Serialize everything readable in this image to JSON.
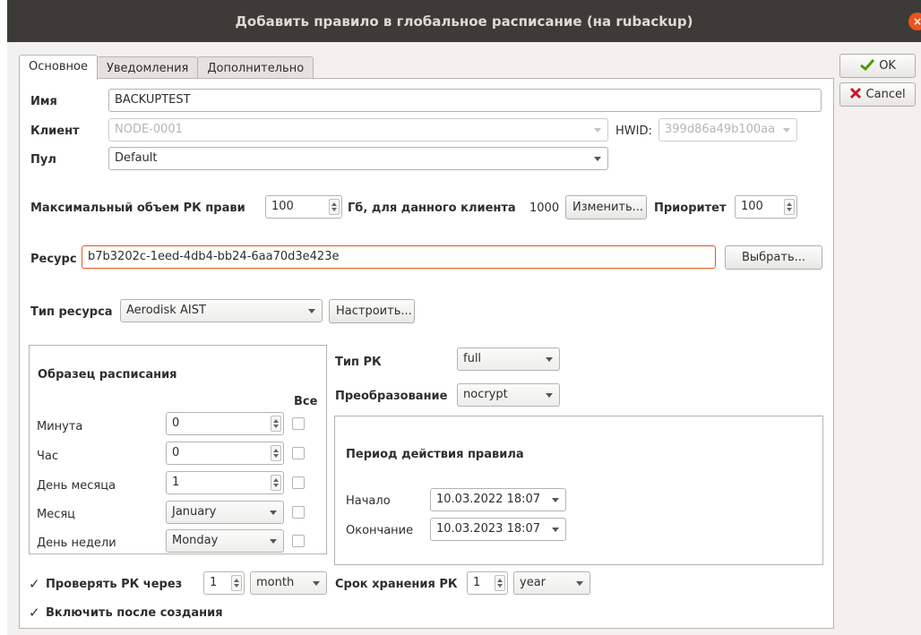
{
  "window": {
    "title": "Добавить правило в глобальное расписание (на rubackup)",
    "close_glyph": "×"
  },
  "tabs": [
    "Основное",
    "Уведомления",
    "Дополнительно"
  ],
  "side_buttons": {
    "ok": "OK",
    "cancel": "Cancel",
    "ok_icon": "ok-check-icon",
    "cancel_icon": "cancel-x-icon"
  },
  "form": {
    "name_label": "Имя",
    "name_value": "BACKUPTEST",
    "client_label": "Клиент",
    "client_value": "NODE-0001",
    "hwid_label": "HWID:",
    "hwid_value": "399d86a49b100aa",
    "pool_label": "Пул",
    "pool_value": "Default",
    "maxvol_label": "Максимальный объем РК прави",
    "maxvol_value": "100",
    "gb_label": "Гб, для данного клиента",
    "client_total": "1000",
    "change_button": "Изменить...",
    "priority_label": "Приоритет",
    "priority_value": "100",
    "resource_label": "Ресурс",
    "resource_value": "b7b3202c-1eed-4db4-bb24-6aa70d3e423e",
    "choose_button": "Выбрать...",
    "restype_label": "Тип ресурса",
    "restype_value": "Aerodisk AIST",
    "configure_button": "Настроить..."
  },
  "schedule": {
    "title": "Образец расписания",
    "all_label": "Все",
    "rows": [
      {
        "label": "Минута",
        "value": "0",
        "kind": "spin"
      },
      {
        "label": "Час",
        "value": "0",
        "kind": "spin"
      },
      {
        "label": "День месяца",
        "value": "1",
        "kind": "spin"
      },
      {
        "label": "Месяц",
        "value": "January",
        "kind": "combo"
      },
      {
        "label": "День недели",
        "value": "Monday",
        "kind": "combo"
      }
    ]
  },
  "backup": {
    "type_label": "Тип РК",
    "type_value": "full",
    "transform_label": "Преобразование",
    "transform_value": "nocrypt"
  },
  "period": {
    "title": "Период действия правила",
    "start_label": "Начало",
    "start_value": "10.03.2022 18:07",
    "end_label": "Окончание",
    "end_value": "10.03.2023 18:07"
  },
  "bottom": {
    "check_label": "Проверять РК через",
    "check_checked": true,
    "check_value": "1",
    "check_unit": "month",
    "retention_label": "Срок хранения РК",
    "retention_value": "1",
    "retention_unit": "year",
    "enable_label": "Включить после создания",
    "enable_checked": true,
    "check_glyph": "✓"
  }
}
